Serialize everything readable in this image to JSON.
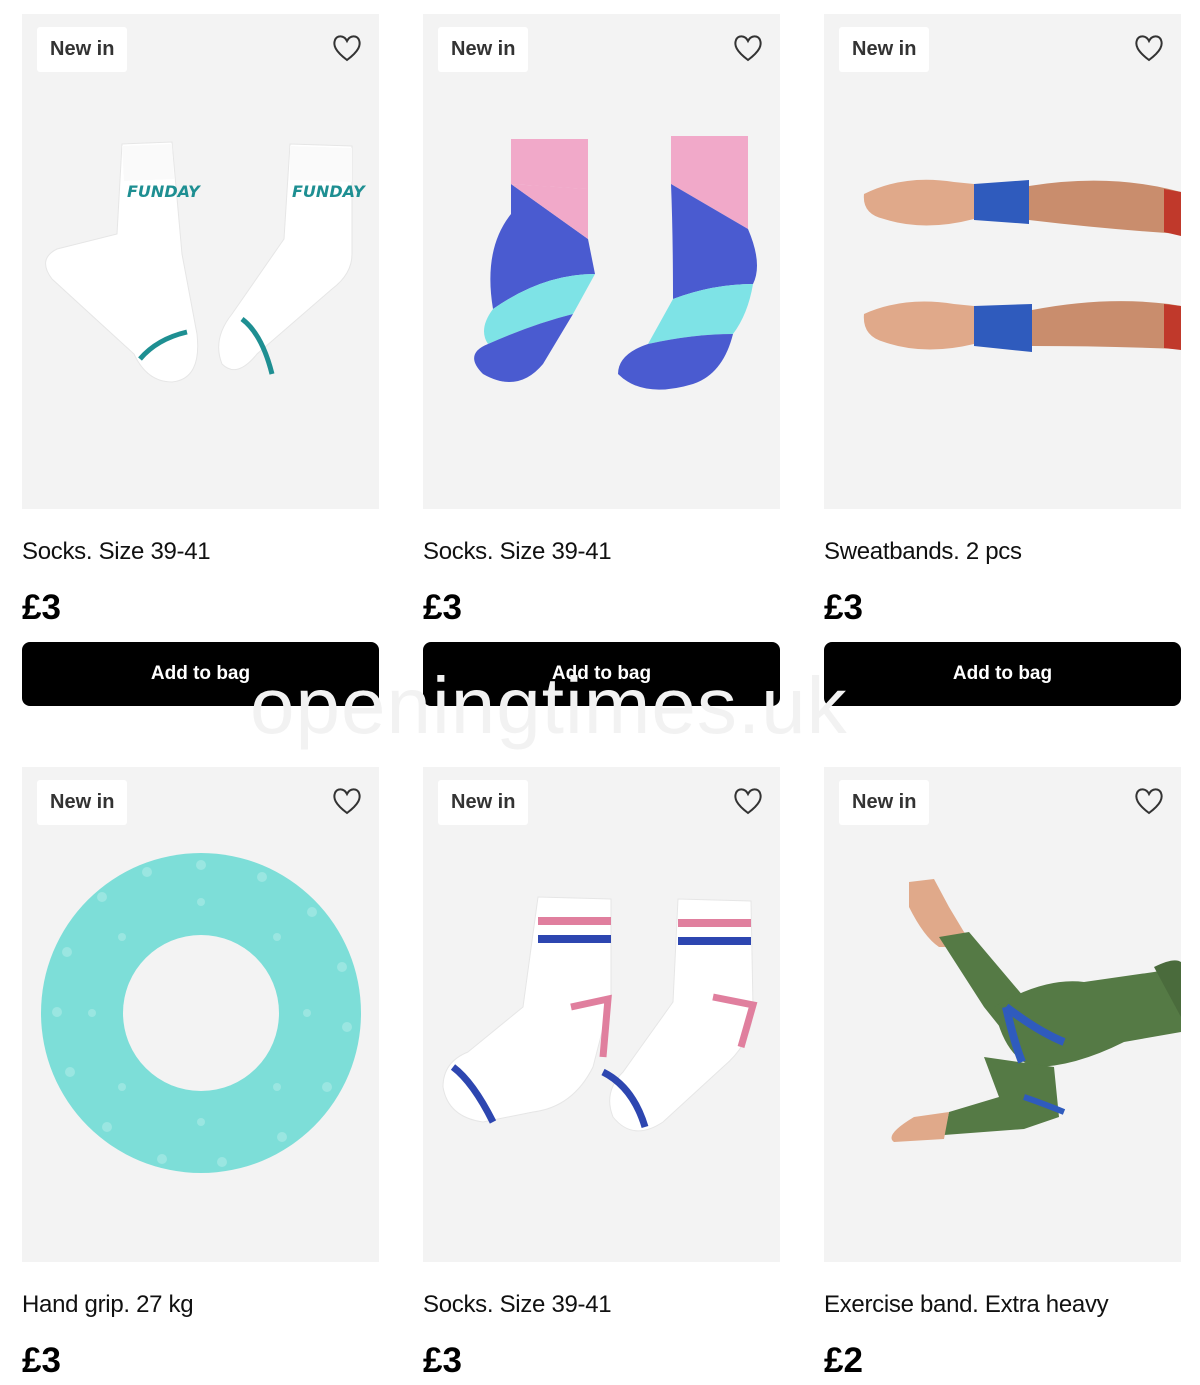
{
  "products": [
    {
      "badge": "New in",
      "title": "Socks. Size 39-41",
      "price": "£3",
      "button": "Add to bag",
      "favorite_icon": "heart-outline-icon"
    },
    {
      "badge": "New in",
      "title": "Socks. Size 39-41",
      "price": "£3",
      "button": "Add to bag",
      "favorite_icon": "heart-outline-icon"
    },
    {
      "badge": "New in",
      "title": "Sweatbands. 2 pcs",
      "price": "£3",
      "button": "Add to bag",
      "favorite_icon": "heart-outline-icon"
    },
    {
      "badge": "New in",
      "title": "Hand grip. 27 kg",
      "price": "£3",
      "favorite_icon": "heart-outline-icon"
    },
    {
      "badge": "New in",
      "title": "Socks. Size 39-41",
      "price": "£3",
      "favorite_icon": "heart-outline-icon"
    },
    {
      "badge": "New in",
      "title": "Exercise band. Extra heavy",
      "price": "£2",
      "favorite_icon": "heart-outline-icon"
    }
  ],
  "sock_logo": "FUNDAY",
  "watermark": "openingtimes.uk",
  "colors": {
    "button_bg": "#000000",
    "image_bg": "#f3f3f3",
    "sock_teal": "#1e8f92",
    "sock_pink": "#f1a9c9",
    "sock_blue": "#4a5bd0",
    "sock_aqua": "#7ee3e6",
    "sweatband_blue": "#2f5bbd",
    "grip_mint": "#7dded8",
    "legging_green": "#557a45"
  }
}
